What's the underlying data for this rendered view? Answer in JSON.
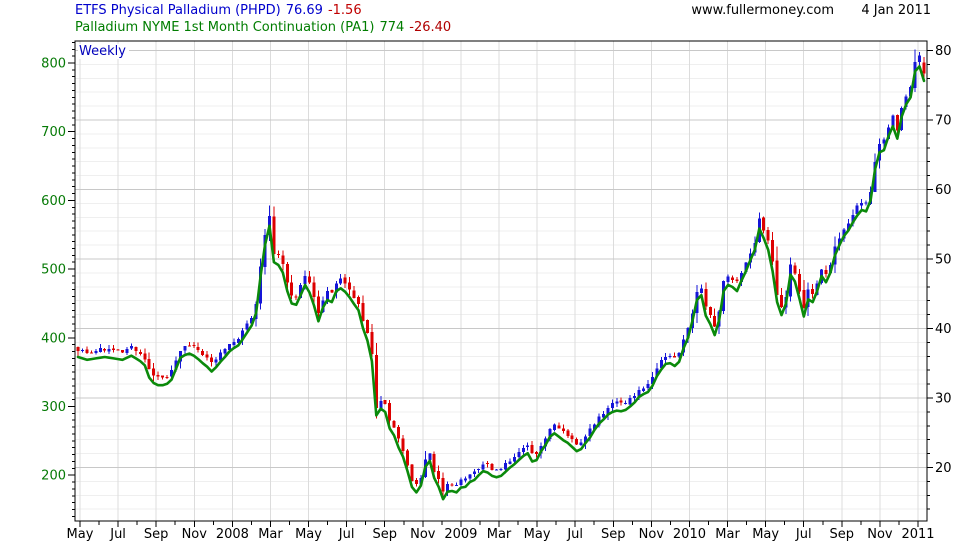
{
  "header": {
    "series1": {
      "name": "ETFS Physical Palladium (PHPD)",
      "last": "76.69",
      "change": "-1.56",
      "name_color": "#0000cc",
      "change_color": "#c00000"
    },
    "series2": {
      "name": "Palladium NYME 1st Month Continuation (PA1)",
      "last": "774",
      "change": "-26.40",
      "name_color": "#007d00",
      "change_color": "#b00000"
    },
    "watermark": "www.fullermoney.com",
    "date": "4 Jan 2011"
  },
  "weekly_label": "Weekly",
  "chart_data": {
    "type": "candlestick_with_line",
    "timeframe": "Weekly",
    "x_axis": {
      "start": "May 2007",
      "end": "Jan 2011",
      "months_total": 44,
      "tick_every_months": 1,
      "label_every_months": 2,
      "month_tick_labels": [
        "May",
        "Jul",
        "Sep",
        "Nov",
        "2008",
        "Mar",
        "May",
        "Jul",
        "Sep",
        "Nov",
        "2009",
        "Mar",
        "May",
        "Jul",
        "Sep",
        "Nov",
        "2010",
        "Mar",
        "May",
        "Jul",
        "Sep",
        "Nov",
        "2011"
      ]
    },
    "left_axis": {
      "series": "Palladium NYME 1st Month Continuation (PA1)",
      "tick_labels": [
        800,
        700,
        600,
        500,
        400,
        300,
        200
      ],
      "minor_step": 10,
      "label_color": "#067a06"
    },
    "right_axis": {
      "series": "ETFS Physical Palladium (PHPD)",
      "tick_labels": [
        80,
        70,
        60,
        50,
        40,
        30,
        20
      ],
      "minor_step": 2,
      "label_color": "#000000"
    },
    "series": [
      {
        "name": "PA1 weekly close (left axis)",
        "type": "line",
        "color": "#0b8a0b",
        "last_value": 774,
        "weekly_values": [
          372,
          370,
          368,
          369,
          370,
          371,
          372,
          371,
          370,
          369,
          368,
          371,
          374,
          370,
          366,
          360,
          342,
          334,
          331,
          331,
          333,
          339,
          355,
          371,
          375,
          377,
          374,
          369,
          363,
          358,
          351,
          357,
          365,
          372,
          380,
          385,
          389,
          398,
          408,
          418,
          436,
          490,
          535,
          563,
          510,
          506,
          495,
          468,
          450,
          448,
          462,
          477,
          466,
          447,
          424,
          444,
          455,
          452,
          468,
          472,
          467,
          459,
          449,
          440,
          414,
          396,
          366,
          287,
          297,
          292,
          268,
          258,
          240,
          227,
          206,
          183,
          175,
          185,
          212,
          221,
          196,
          183,
          165,
          176,
          177,
          175,
          182,
          183,
          190,
          193,
          200,
          206,
          204,
          199,
          197,
          199,
          205,
          211,
          216,
          222,
          228,
          232,
          220,
          222,
          235,
          244,
          256,
          261,
          256,
          251,
          247,
          241,
          235,
          238,
          247,
          255,
          266,
          275,
          281,
          288,
          292,
          294,
          293,
          295,
          300,
          306,
          314,
          318,
          321,
          330,
          344,
          354,
          362,
          363,
          359,
          365,
          385,
          400,
          425,
          455,
          462,
          432,
          420,
          404,
          426,
          468,
          477,
          474,
          468,
          483,
          497,
          513,
          528,
          559,
          545,
          528,
          497,
          452,
          433,
          450,
          492,
          482,
          458,
          431,
          456,
          452,
          468,
          490,
          481,
          495,
          520,
          535,
          548,
          556,
          568,
          578,
          586,
          584,
          600,
          645,
          670,
          673,
          693,
          708,
          690,
          722,
          740,
          750,
          788,
          795,
          774
        ]
      },
      {
        "name": "PHPD weekly candles (right axis)",
        "type": "candlestick",
        "up_color": "#1515d8",
        "down_color": "#dd0000",
        "last_open": 78.25,
        "last_close": 76.69,
        "ratio_to_pa1": 0.0995
      }
    ],
    "grid": {
      "h_major_color": "#c8c8c8",
      "h_minor_color": "#efefef",
      "v_color": "#dcdcdc",
      "frame_color": "#000000"
    }
  }
}
